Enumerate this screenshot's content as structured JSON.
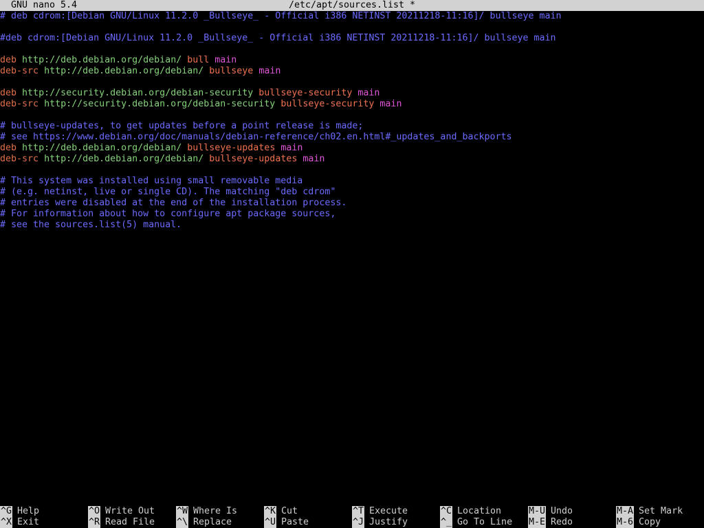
{
  "titlebar": {
    "app": "GNU nano 5.4",
    "file": "/etc/apt/sources.list *"
  },
  "lines": [
    {
      "segments": [
        {
          "text": "# deb cdrom:[Debian GNU/Linux 11.2.0 _Bullseye_ - Official i386 NETINST 20211218-11:16]/ bullseye main",
          "cls": "c-comment"
        }
      ]
    },
    {
      "segments": []
    },
    {
      "segments": [
        {
          "text": "#deb cdrom:[Debian GNU/Linux 11.2.0 _Bullseye_ - Official i386 NETINST 20211218-11:16]/ bullseye main",
          "cls": "c-comment"
        }
      ]
    },
    {
      "segments": []
    },
    {
      "segments": [
        {
          "text": "deb",
          "cls": "c-type"
        },
        {
          "text": " ",
          "cls": "c-text"
        },
        {
          "text": "http://deb.debian.org/debian/",
          "cls": "c-url"
        },
        {
          "text": " ",
          "cls": "c-text"
        },
        {
          "text": "bull",
          "cls": "c-suite"
        },
        {
          "text": " ",
          "cls": "c-text"
        },
        {
          "text": "main",
          "cls": "c-comp"
        }
      ]
    },
    {
      "segments": [
        {
          "text": "deb-src",
          "cls": "c-type"
        },
        {
          "text": " ",
          "cls": "c-text"
        },
        {
          "text": "http://deb.debian.org/debian/",
          "cls": "c-url"
        },
        {
          "text": " ",
          "cls": "c-text"
        },
        {
          "text": "bullseye",
          "cls": "c-suite"
        },
        {
          "text": " ",
          "cls": "c-text"
        },
        {
          "text": "main",
          "cls": "c-comp"
        }
      ]
    },
    {
      "segments": []
    },
    {
      "segments": [
        {
          "text": "deb",
          "cls": "c-type"
        },
        {
          "text": " ",
          "cls": "c-text"
        },
        {
          "text": "http://security.debian.org/debian-security",
          "cls": "c-url"
        },
        {
          "text": " ",
          "cls": "c-text"
        },
        {
          "text": "bullseye-security",
          "cls": "c-suite"
        },
        {
          "text": " ",
          "cls": "c-text"
        },
        {
          "text": "main",
          "cls": "c-comp"
        }
      ]
    },
    {
      "segments": [
        {
          "text": "deb-src",
          "cls": "c-type"
        },
        {
          "text": " ",
          "cls": "c-text"
        },
        {
          "text": "http://security.debian.org/debian-security",
          "cls": "c-url"
        },
        {
          "text": " ",
          "cls": "c-text"
        },
        {
          "text": "bullseye-security",
          "cls": "c-suite"
        },
        {
          "text": " ",
          "cls": "c-text"
        },
        {
          "text": "main",
          "cls": "c-comp"
        }
      ]
    },
    {
      "segments": []
    },
    {
      "segments": [
        {
          "text": "# bullseye-updates, to get updates before a point release is made;",
          "cls": "c-comment"
        }
      ]
    },
    {
      "segments": [
        {
          "text": "# see https://www.debian.org/doc/manuals/debian-reference/ch02.en.html#_updates_and_backports",
          "cls": "c-comment"
        }
      ]
    },
    {
      "segments": [
        {
          "text": "deb",
          "cls": "c-type"
        },
        {
          "text": " ",
          "cls": "c-text"
        },
        {
          "text": "http://deb.debian.org/debian/",
          "cls": "c-url"
        },
        {
          "text": " ",
          "cls": "c-text"
        },
        {
          "text": "bullseye-updates",
          "cls": "c-suite"
        },
        {
          "text": " ",
          "cls": "c-text"
        },
        {
          "text": "main",
          "cls": "c-comp"
        }
      ]
    },
    {
      "segments": [
        {
          "text": "deb-src",
          "cls": "c-type"
        },
        {
          "text": " ",
          "cls": "c-text"
        },
        {
          "text": "http://deb.debian.org/debian/",
          "cls": "c-url"
        },
        {
          "text": " ",
          "cls": "c-text"
        },
        {
          "text": "bullseye-updates",
          "cls": "c-suite"
        },
        {
          "text": " ",
          "cls": "c-text"
        },
        {
          "text": "main",
          "cls": "c-comp"
        }
      ]
    },
    {
      "segments": []
    },
    {
      "segments": [
        {
          "text": "# This system was installed using small removable media",
          "cls": "c-comment"
        }
      ]
    },
    {
      "segments": [
        {
          "text": "# (e.g. netinst, live or single CD). The matching \"deb cdrom\"",
          "cls": "c-comment"
        }
      ]
    },
    {
      "segments": [
        {
          "text": "# entries were disabled at the end of the installation process.",
          "cls": "c-comment"
        }
      ]
    },
    {
      "segments": [
        {
          "text": "# For information about how to configure apt package sources,",
          "cls": "c-comment"
        }
      ]
    },
    {
      "segments": [
        {
          "text": "# see the sources.list(5) manual.",
          "cls": "c-comment"
        }
      ]
    }
  ],
  "shortcuts_row1": [
    {
      "key": "^G",
      "label": "Help"
    },
    {
      "key": "^O",
      "label": "Write Out"
    },
    {
      "key": "^W",
      "label": "Where Is"
    },
    {
      "key": "^K",
      "label": "Cut"
    },
    {
      "key": "^T",
      "label": "Execute"
    },
    {
      "key": "^C",
      "label": "Location"
    },
    {
      "key": "M-U",
      "label": "Undo"
    },
    {
      "key": "M-A",
      "label": "Set Mark"
    }
  ],
  "shortcuts_row2": [
    {
      "key": "^X",
      "label": "Exit"
    },
    {
      "key": "^R",
      "label": "Read File"
    },
    {
      "key": "^\\",
      "label": "Replace"
    },
    {
      "key": "^U",
      "label": "Paste"
    },
    {
      "key": "^J",
      "label": "Justify"
    },
    {
      "key": "^_",
      "label": "Go To Line"
    },
    {
      "key": "M-E",
      "label": "Redo"
    },
    {
      "key": "M-6",
      "label": "Copy"
    }
  ],
  "colors": {
    "background": "#000000",
    "bar": "#d2d2d2",
    "comment": "#6b6bff",
    "type": "#e0704a",
    "url": "#86d17c",
    "suite": "#f0734f",
    "component": "#e055d8"
  }
}
